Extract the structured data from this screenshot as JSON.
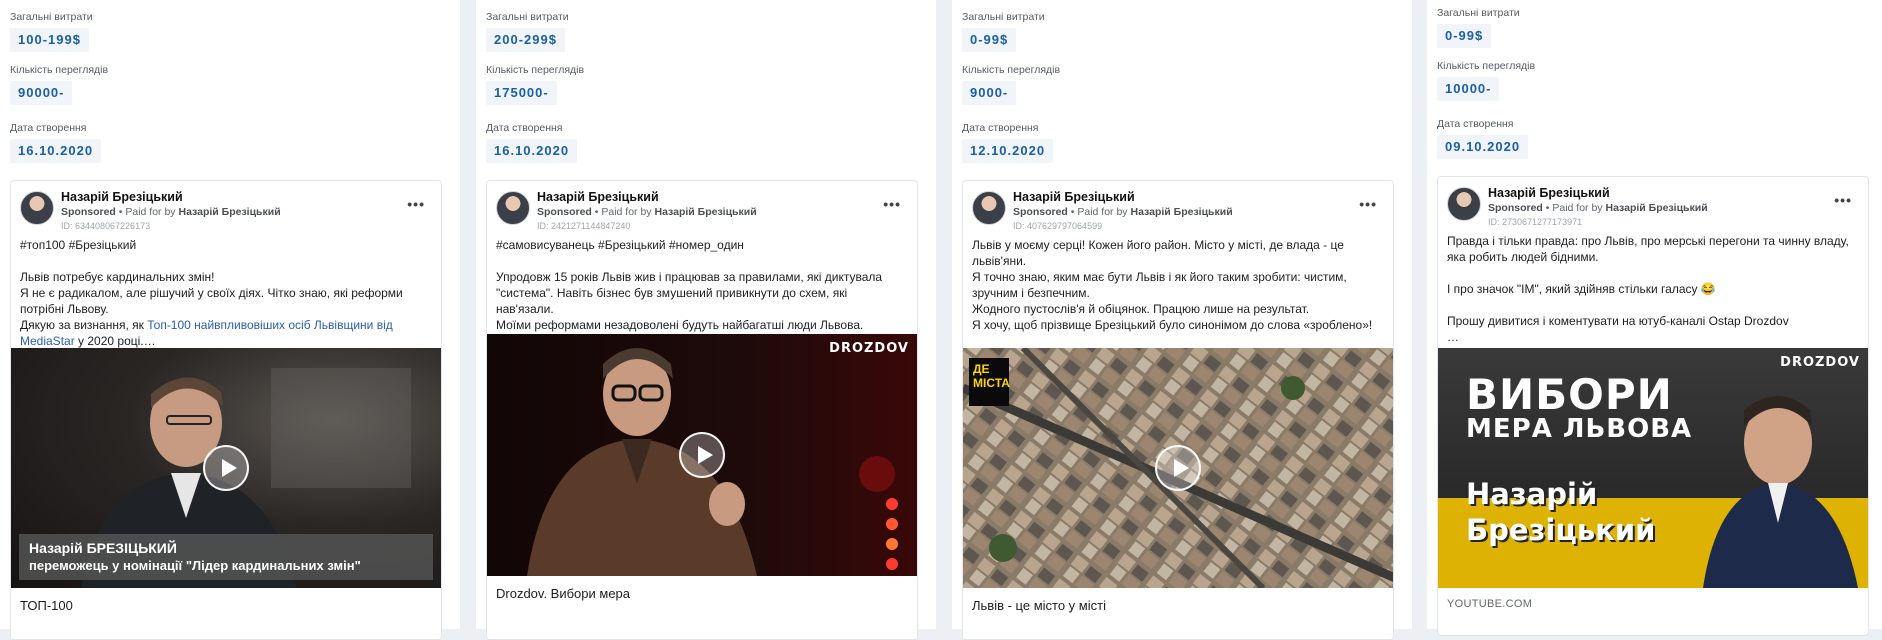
{
  "labels": {
    "spend": "Загальні витрати",
    "views": "Кількість переглядів",
    "created": "Дата створення",
    "sponsored": "Sponsored",
    "paid_for_by": "• Paid for by"
  },
  "ads": [
    {
      "spend": "100-199$",
      "views": "90000-",
      "created": "16.10.2020",
      "author": "Назарій Брезіцький",
      "payer": "Назарій Брезіцький",
      "ad_id": "ID: 634408067226173",
      "text_main": "#топ100 #Брезіцький\n\nЛьвів потребує кардинальних змін!\nЯ не є радикалом, але рішучий у своїх діях. Чітко знаю, які реформи потрібні Львову.\nДякую за визнання, як ",
      "text_link": "Топ-100 найвпливовіших осіб Львівщини від MediaStar",
      "text_tail": " у 2020 році.…",
      "banner_line1": "Назарій БРЕЗІЦЬКИЙ",
      "banner_line2": "переможець у номінації \"Лідер кардинальних змін\"",
      "caption": "ТОП-100"
    },
    {
      "spend": "200-299$",
      "views": "175000-",
      "created": "16.10.2020",
      "author": "Назарій Брезіцький",
      "payer": "Назарій Брезіцький",
      "ad_id": "ID: 2421271144847240",
      "text": "#самовисуванець #Брезіцький #номер_один\n\nУпродовж 15 років Львів жив і працював за правилами, які диктувала \"система\". Навіть бізнес був змушений привикнути до схем, які нав'язали.\nМоїми реформами незадоволені будуть найбагатші люди Львова.\nУ межах Закону вони таки платитимуть податки.",
      "brand": "DROZDOV",
      "caption": "Drozdov. Вибори мера"
    },
    {
      "spend": "0-99$",
      "views": "9000-",
      "created": "12.10.2020",
      "author": "Назарій Брезіцький",
      "payer": "Назарій Брезіцький",
      "ad_id": "ID: 407629797064599",
      "text": "Львів у моєму серці! Кожен його район. Місто у місті, де влада - це львів'яни.\nЯ точно знаю, яким має бути Львів і як його таким зробити: чистим, зручним і безпечним.\nЖодного пустослів'я й обіцянок. Працюю лише на результат.\nЯ хочу, щоб прізвище Брезіцький було синонімом до слова «зроблено»!\n\nПрошу вашої довіри й підтримки!…",
      "badge": "ДЕ МІСТА",
      "caption": "Львів - це місто у місті"
    },
    {
      "spend": "0-99$",
      "views": "10000-",
      "created": "09.10.2020",
      "author": "Назарій Брезіцький",
      "payer": "Назарій Брезіцький",
      "ad_id": "ID: 2730671277173971",
      "text": "Правда і тільки правда: про Львів, про мерські перегони та чинну владу, яка робить людей бідними.\n\nІ про значок \"ІМ\", який здійняв стільки галасу 😂\n\nПрошу дивитися і коментувати на ютуб-каналі Ostap Drozdov\n…",
      "brand": "DROZDOV",
      "title_line1": "ВИБОРИ",
      "title_line2": "МЕРА ЛЬВОВА",
      "name_line1": "Назарій",
      "name_line2": "Брезіцький",
      "caption": "YOUTUBE.COM"
    }
  ],
  "colors": {
    "value_blue": "#1b5fa8",
    "link_blue": "#2a5db0",
    "value_bg": "#f1f4f8"
  },
  "icons": {
    "more": "more-options-icon",
    "play": "play-icon",
    "avatar": "avatar"
  }
}
